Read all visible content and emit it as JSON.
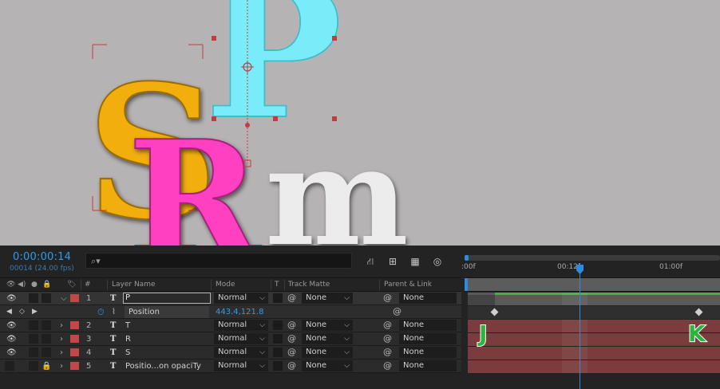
{
  "composition": {
    "letters": [
      "P",
      "S",
      "R",
      "m"
    ]
  },
  "timeline": {
    "timecode": "0:00:00:14",
    "framecode": "00014 (24.00 fps)",
    "search_icon": "search-icon",
    "headers": {
      "num": "#",
      "layer_name": "Layer Name",
      "mode": "Mode",
      "t": "T",
      "track_matte": "Track Matte",
      "parent": "Parent & Link"
    },
    "layers": [
      {
        "num": "1",
        "name": "P",
        "mode": "Normal",
        "matte": "None",
        "parent": "None",
        "editing": true,
        "expanded": true
      },
      {
        "num": "2",
        "name": "T",
        "mode": "Normal",
        "matte": "None",
        "parent": "None"
      },
      {
        "num": "3",
        "name": "R",
        "mode": "Normal",
        "matte": "None",
        "parent": "None"
      },
      {
        "num": "4",
        "name": "S",
        "mode": "Normal",
        "matte": "None",
        "parent": "None"
      },
      {
        "num": "5",
        "name": "Positio...on opaciTy",
        "mode": "Normal",
        "matte": "None",
        "parent": "None",
        "locked": true
      }
    ],
    "layer_type_symbol": "T",
    "property": {
      "name": "Position",
      "value": "443.4,121.8"
    },
    "ruler_ticks": [
      ":00f",
      "00:12f",
      "01:00f"
    ],
    "annotations": [
      "J",
      "K"
    ],
    "colors": {
      "accent": "#2f9bea",
      "label_red": "#c44747",
      "bar_red": "#7a3c3c",
      "bar_green": "#3fb344",
      "annotation_green": "#2bb53f"
    }
  }
}
